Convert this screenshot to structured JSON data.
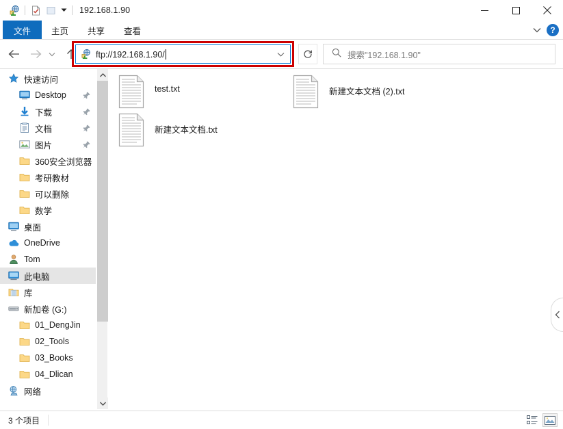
{
  "window": {
    "title": "192.168.1.90",
    "quick_access_toolbar": [
      {
        "name": "folder-properties-icon",
        "label": "属性"
      },
      {
        "name": "new-folder-icon",
        "label": "新建文件夹"
      },
      {
        "name": "customize-qat-icon",
        "label": "自定义快速访问工具栏"
      }
    ],
    "controls": {
      "minimize": "—",
      "maximize": "□",
      "close": "✕"
    }
  },
  "ribbon": {
    "tabs": [
      {
        "label": "文件",
        "active": true
      },
      {
        "label": "主页",
        "active": false
      },
      {
        "label": "共享",
        "active": false
      },
      {
        "label": "查看",
        "active": false
      }
    ],
    "expand_label": "展开功能区",
    "help_label": "?"
  },
  "navigation": {
    "back_label": "后退",
    "forward_label": "前进",
    "recent_label": "最近浏览的位置",
    "up_label": "上一级",
    "address": {
      "value": "ftp://192.168.1.90/",
      "icon": "ftp-site-icon",
      "dropdown_label": "历史记录"
    },
    "refresh_label": "刷新",
    "search": {
      "placeholder": "搜索\"192.168.1.90\"",
      "value": "搜索\"192.168.1.90\""
    }
  },
  "sidebar": {
    "items": [
      {
        "label": "快速访问",
        "icon": "star-icon",
        "indent": 0,
        "pinned": false,
        "selected": false
      },
      {
        "label": "Desktop",
        "icon": "desktop-icon",
        "indent": 1,
        "pinned": true,
        "selected": false
      },
      {
        "label": "下载",
        "icon": "download-icon",
        "indent": 1,
        "pinned": true,
        "selected": false
      },
      {
        "label": "文档",
        "icon": "documents-icon",
        "indent": 1,
        "pinned": true,
        "selected": false
      },
      {
        "label": "图片",
        "icon": "pictures-icon",
        "indent": 1,
        "pinned": true,
        "selected": false
      },
      {
        "label": "360安全浏览器",
        "icon": "folder-icon",
        "indent": 1,
        "pinned": false,
        "selected": false
      },
      {
        "label": "考研教材",
        "icon": "folder-icon",
        "indent": 1,
        "pinned": false,
        "selected": false
      },
      {
        "label": "可以删除",
        "icon": "folder-icon",
        "indent": 1,
        "pinned": false,
        "selected": false
      },
      {
        "label": "数学",
        "icon": "folder-icon",
        "indent": 1,
        "pinned": false,
        "selected": false
      },
      {
        "label": "桌面",
        "icon": "desktop-icon",
        "indent": 0,
        "pinned": false,
        "selected": false
      },
      {
        "label": "OneDrive",
        "icon": "onedrive-icon",
        "indent": 0,
        "pinned": false,
        "selected": false
      },
      {
        "label": "Tom",
        "icon": "user-icon",
        "indent": 0,
        "pinned": false,
        "selected": false
      },
      {
        "label": "此电脑",
        "icon": "computer-icon",
        "indent": 0,
        "pinned": false,
        "selected": true
      },
      {
        "label": "库",
        "icon": "libraries-icon",
        "indent": 0,
        "pinned": false,
        "selected": false
      },
      {
        "label": "新加卷 (G:)",
        "icon": "drive-icon",
        "indent": 0,
        "pinned": false,
        "selected": false
      },
      {
        "label": "01_DengJin",
        "icon": "folder-icon",
        "indent": 1,
        "pinned": false,
        "selected": false
      },
      {
        "label": "02_Tools",
        "icon": "folder-icon",
        "indent": 1,
        "pinned": false,
        "selected": false
      },
      {
        "label": "03_Books",
        "icon": "folder-icon",
        "indent": 1,
        "pinned": false,
        "selected": false
      },
      {
        "label": "04_Dlican",
        "icon": "folder-icon",
        "indent": 1,
        "pinned": false,
        "selected": false
      },
      {
        "label": "网络",
        "icon": "network-icon",
        "indent": 0,
        "pinned": false,
        "selected": false
      }
    ],
    "scrollbar": {
      "up_label": "向上滚动",
      "down_label": "向下滚动"
    }
  },
  "files": {
    "items": [
      {
        "name": "test.txt",
        "icon": "text-file-icon",
        "col": 0,
        "row": 0
      },
      {
        "name": "新建文本文档 (2).txt",
        "icon": "text-file-icon",
        "col": 1,
        "row": 0
      },
      {
        "name": "新建文本文档.txt",
        "icon": "text-file-icon",
        "col": 0,
        "row": 1
      }
    ]
  },
  "preview_pane": {
    "toggle_label": "‹"
  },
  "statusbar": {
    "count_text": "3 个项目",
    "views": [
      {
        "name": "details-view-icon",
        "label": "详细信息",
        "active": false
      },
      {
        "name": "large-icons-view-icon",
        "label": "大图标",
        "active": true
      }
    ]
  },
  "colors": {
    "accent": "#0f6cbd",
    "highlight_border": "#cc0000",
    "focus_border": "#0078d7",
    "selection": "#e5e5e5"
  }
}
